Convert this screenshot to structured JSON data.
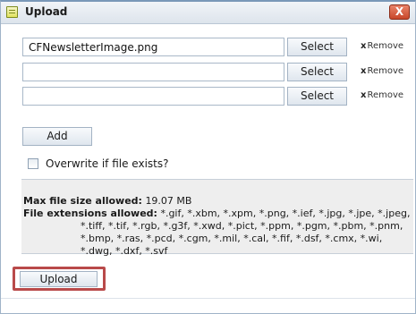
{
  "dialog": {
    "title": "Upload",
    "close_label": "X",
    "icon": "upload-dialog-icon"
  },
  "files": [
    {
      "value": "CFNewsletterImage.png",
      "select_label": "Select",
      "remove_label": "Remove",
      "remove_icon": "x"
    },
    {
      "value": "",
      "select_label": "Select",
      "remove_label": "Remove",
      "remove_icon": "x"
    },
    {
      "value": "",
      "select_label": "Select",
      "remove_label": "Remove",
      "remove_icon": "x"
    }
  ],
  "add_label": "Add",
  "overwrite": {
    "label": "Overwrite if file exists?",
    "checked": false
  },
  "info": {
    "max_size_label": "Max file size allowed:",
    "max_size_value": "19.07 MB",
    "extensions_label": "File extensions allowed:",
    "extensions_line1": "*.gif, *.xbm, *.xpm, *.png, *.ief, *.jpg, *.jpe, *.jpeg,",
    "extensions_rest": "*.tiff, *.tif, *.rgb, *.g3f, *.xwd, *.pict, *.ppm, *.pgm, *.pbm, *.pnm, *.bmp, *.ras, *.pcd, *.cgm, *.mil, *.cal, *.fif, *.dsf, *.cmx, *.wi, *.dwg, *.dxf, *.svf"
  },
  "upload_label": "Upload",
  "colors": {
    "highlight": "#b94a4a",
    "close": "#c8472a"
  }
}
